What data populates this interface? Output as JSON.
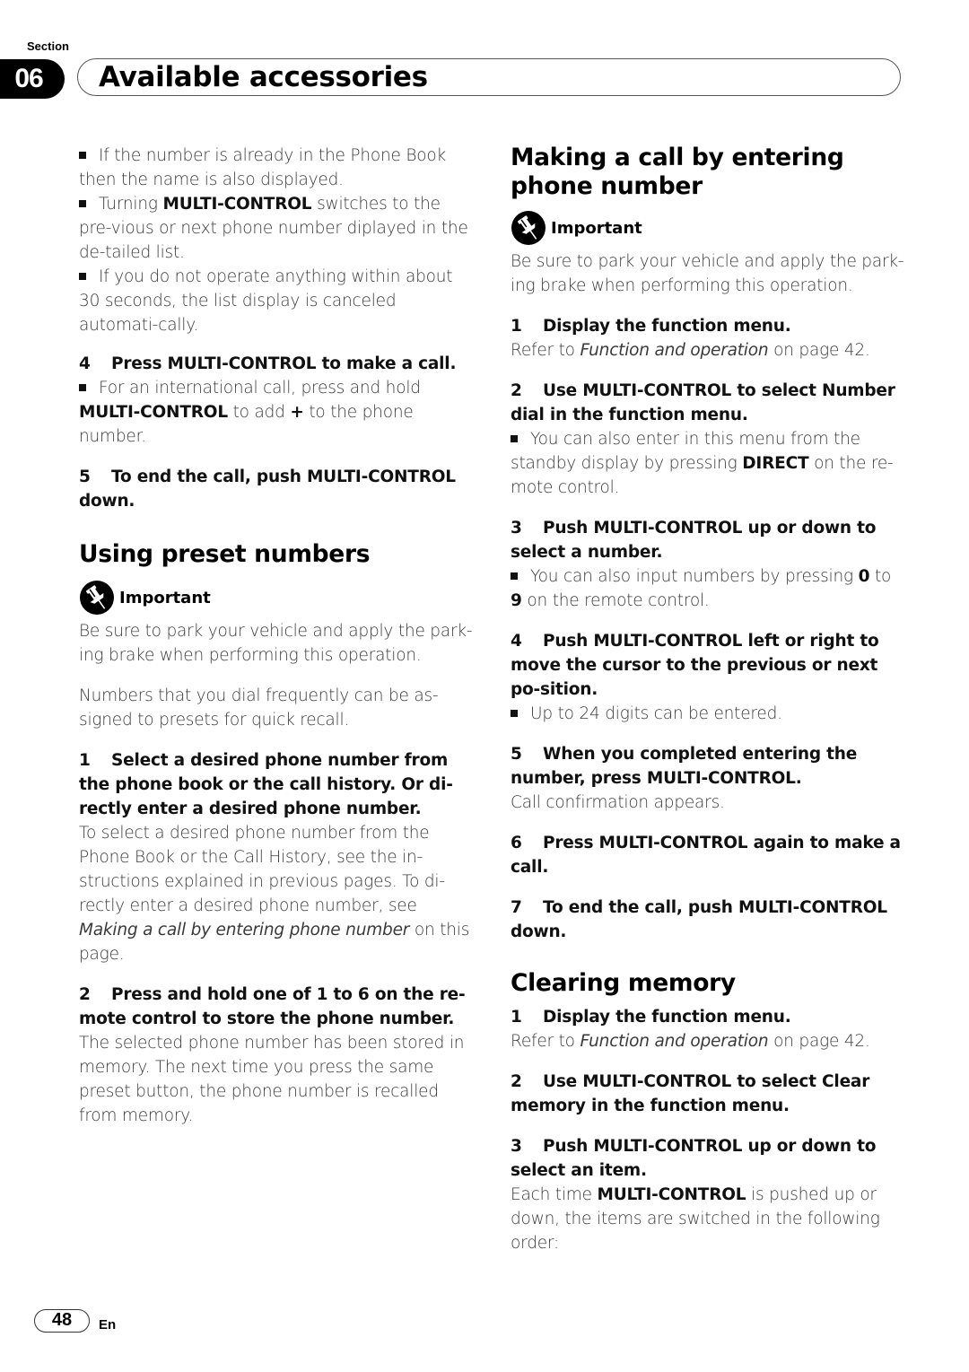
{
  "header": {
    "section_label": "Section",
    "section_number": "06",
    "title": "Available accessories"
  },
  "left": {
    "bullets_top": [
      {
        "parts": [
          {
            "t": "If the number is already in the Phone Book then the name is also displayed."
          }
        ]
      },
      {
        "parts": [
          {
            "t": "Turning "
          },
          {
            "t": "MULTI-CONTROL",
            "b": true
          },
          {
            "t": " switches to the pre-vious or next phone number diplayed in the de-tailed list."
          }
        ]
      },
      {
        "parts": [
          {
            "t": "If you do not operate anything within about 30 seconds, the list display is canceled automati-cally."
          }
        ]
      }
    ],
    "step4": {
      "num": "4",
      "text": "Press MULTI-CONTROL to make a call."
    },
    "step4_bullet": [
      {
        "t": "For an international call, press and hold "
      },
      {
        "t": "MULTI-CONTROL",
        "b": true
      },
      {
        "t": " to add "
      },
      {
        "t": "+",
        "b": true
      },
      {
        "t": " to the phone number."
      }
    ],
    "step5": {
      "num": "5",
      "text": "To end the call, push MULTI-CONTROL down."
    },
    "preset_heading": "Using preset numbers",
    "important_label": "Important",
    "important_text": "Be sure to park your vehicle and apply the park-ing brake when performing this operation.",
    "preset_intro": "Numbers that you dial frequently can be as-signed to presets for quick recall.",
    "preset_step1": {
      "num": "1",
      "text": "Select a desired phone number from the phone book or the call history. Or di-rectly enter a desired phone number."
    },
    "preset_step1_body": [
      {
        "t": "To select a desired phone number from the Phone Book or the Call History, see the in-structions explained in previous pages. To di-rectly enter a desired phone number, see "
      },
      {
        "t": "Making a call by entering phone number",
        "i": true
      },
      {
        "t": " on this page."
      }
    ],
    "preset_step2": {
      "num": "2",
      "text": "Press and hold one of 1 to 6 on the re-mote control to store the phone number."
    },
    "preset_step2_body": "The selected phone number has been stored in memory. The next time you press the same preset button, the phone number is recalled from memory."
  },
  "right": {
    "making_heading": "Making a call by entering phone number",
    "important_label": "Important",
    "important_text": "Be sure to park your vehicle and apply the park-ing brake when performing this operation.",
    "step1": {
      "num": "1",
      "text": "Display the function menu."
    },
    "step1_body": [
      {
        "t": "Refer to "
      },
      {
        "t": "Function and operation",
        "i": true
      },
      {
        "t": " on page 42."
      }
    ],
    "step2": {
      "num": "2",
      "text": "Use MULTI-CONTROL to select Number dial in the function menu."
    },
    "step2_bullet": [
      {
        "t": "You can also enter in this menu from the standby display by pressing "
      },
      {
        "t": "DIRECT",
        "b": true
      },
      {
        "t": " on the re-mote control."
      }
    ],
    "step3": {
      "num": "3",
      "text": "Push MULTI-CONTROL up or down to select a number."
    },
    "step3_bullet": [
      {
        "t": "You can also input numbers by pressing "
      },
      {
        "t": "0",
        "b": true
      },
      {
        "t": " to "
      },
      {
        "t": "9",
        "b": true
      },
      {
        "t": " on the remote control."
      }
    ],
    "step4": {
      "num": "4",
      "text": "Push MULTI-CONTROL left or right to move the cursor to the previous or next po-sition."
    },
    "step4_bullet": [
      {
        "t": "Up to 24 digits can be entered."
      }
    ],
    "step5": {
      "num": "5",
      "text": "When you completed entering the number, press MULTI-CONTROL."
    },
    "step5_body": "Call confirmation appears.",
    "step6": {
      "num": "6",
      "text": "Press MULTI-CONTROL again to make a call."
    },
    "step7": {
      "num": "7",
      "text": "To end the call, push MULTI-CONTROL down."
    },
    "clearing_heading": "Clearing memory",
    "clear_step1": {
      "num": "1",
      "text": "Display the function menu."
    },
    "clear_step1_body": [
      {
        "t": "Refer to "
      },
      {
        "t": "Function and operation",
        "i": true
      },
      {
        "t": " on page 42."
      }
    ],
    "clear_step2": {
      "num": "2",
      "text": "Use MULTI-CONTROL to select Clear memory in the function menu."
    },
    "clear_step3": {
      "num": "3",
      "text": "Push MULTI-CONTROL up or down to select an item."
    },
    "clear_step3_body": [
      {
        "t": "Each time "
      },
      {
        "t": "MULTI-CONTROL",
        "b": true
      },
      {
        "t": " is pushed up or down, the items are switched in the following order:"
      }
    ]
  },
  "footer": {
    "page_number": "48",
    "language": "En"
  }
}
